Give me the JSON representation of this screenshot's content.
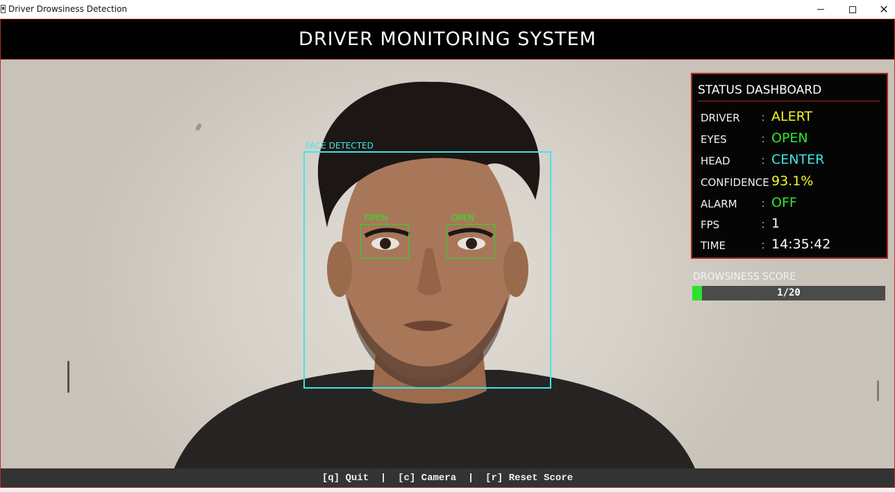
{
  "window": {
    "title": "Driver Drowsiness Detection",
    "controls": {
      "minimize": "minimize",
      "maximize": "maximize",
      "close": "close"
    }
  },
  "header": {
    "title": "DRIVER MONITORING SYSTEM"
  },
  "overlays": {
    "face_label": "FACE DETECTED",
    "left_eye_label": "OPEN",
    "right_eye_label": "OPEN",
    "face_color": "#3ee6e6",
    "eye_color": "#22dd22"
  },
  "dashboard": {
    "title": "STATUS DASHBOARD",
    "rows": [
      {
        "key": "DRIVER",
        "sep": ":",
        "value": "ALERT",
        "color": "#f5f524"
      },
      {
        "key": "EYES",
        "sep": ":",
        "value": "OPEN",
        "color": "#2ee82e"
      },
      {
        "key": "HEAD",
        "sep": ":",
        "value": "CENTER",
        "color": "#3ee6e6"
      },
      {
        "key": "CONFIDENCE",
        "sep": "",
        "value": "93.1%",
        "color": "#f5f524"
      },
      {
        "key": "ALARM",
        "sep": ":",
        "value": "OFF",
        "color": "#2ee82e"
      },
      {
        "key": "FPS",
        "sep": ":",
        "value": "1",
        "color": "#ffffff"
      },
      {
        "key": "TIME",
        "sep": ":",
        "value": "14:35:42",
        "color": "#ffffff"
      }
    ]
  },
  "score": {
    "label": "DROWSINESS SCORE",
    "text": "1/20",
    "value": 1,
    "max": 20,
    "fill_color": "#2ee02e"
  },
  "footer": {
    "controls_text": "[q] Quit  |  [c] Camera  |  [r] Reset Score"
  }
}
